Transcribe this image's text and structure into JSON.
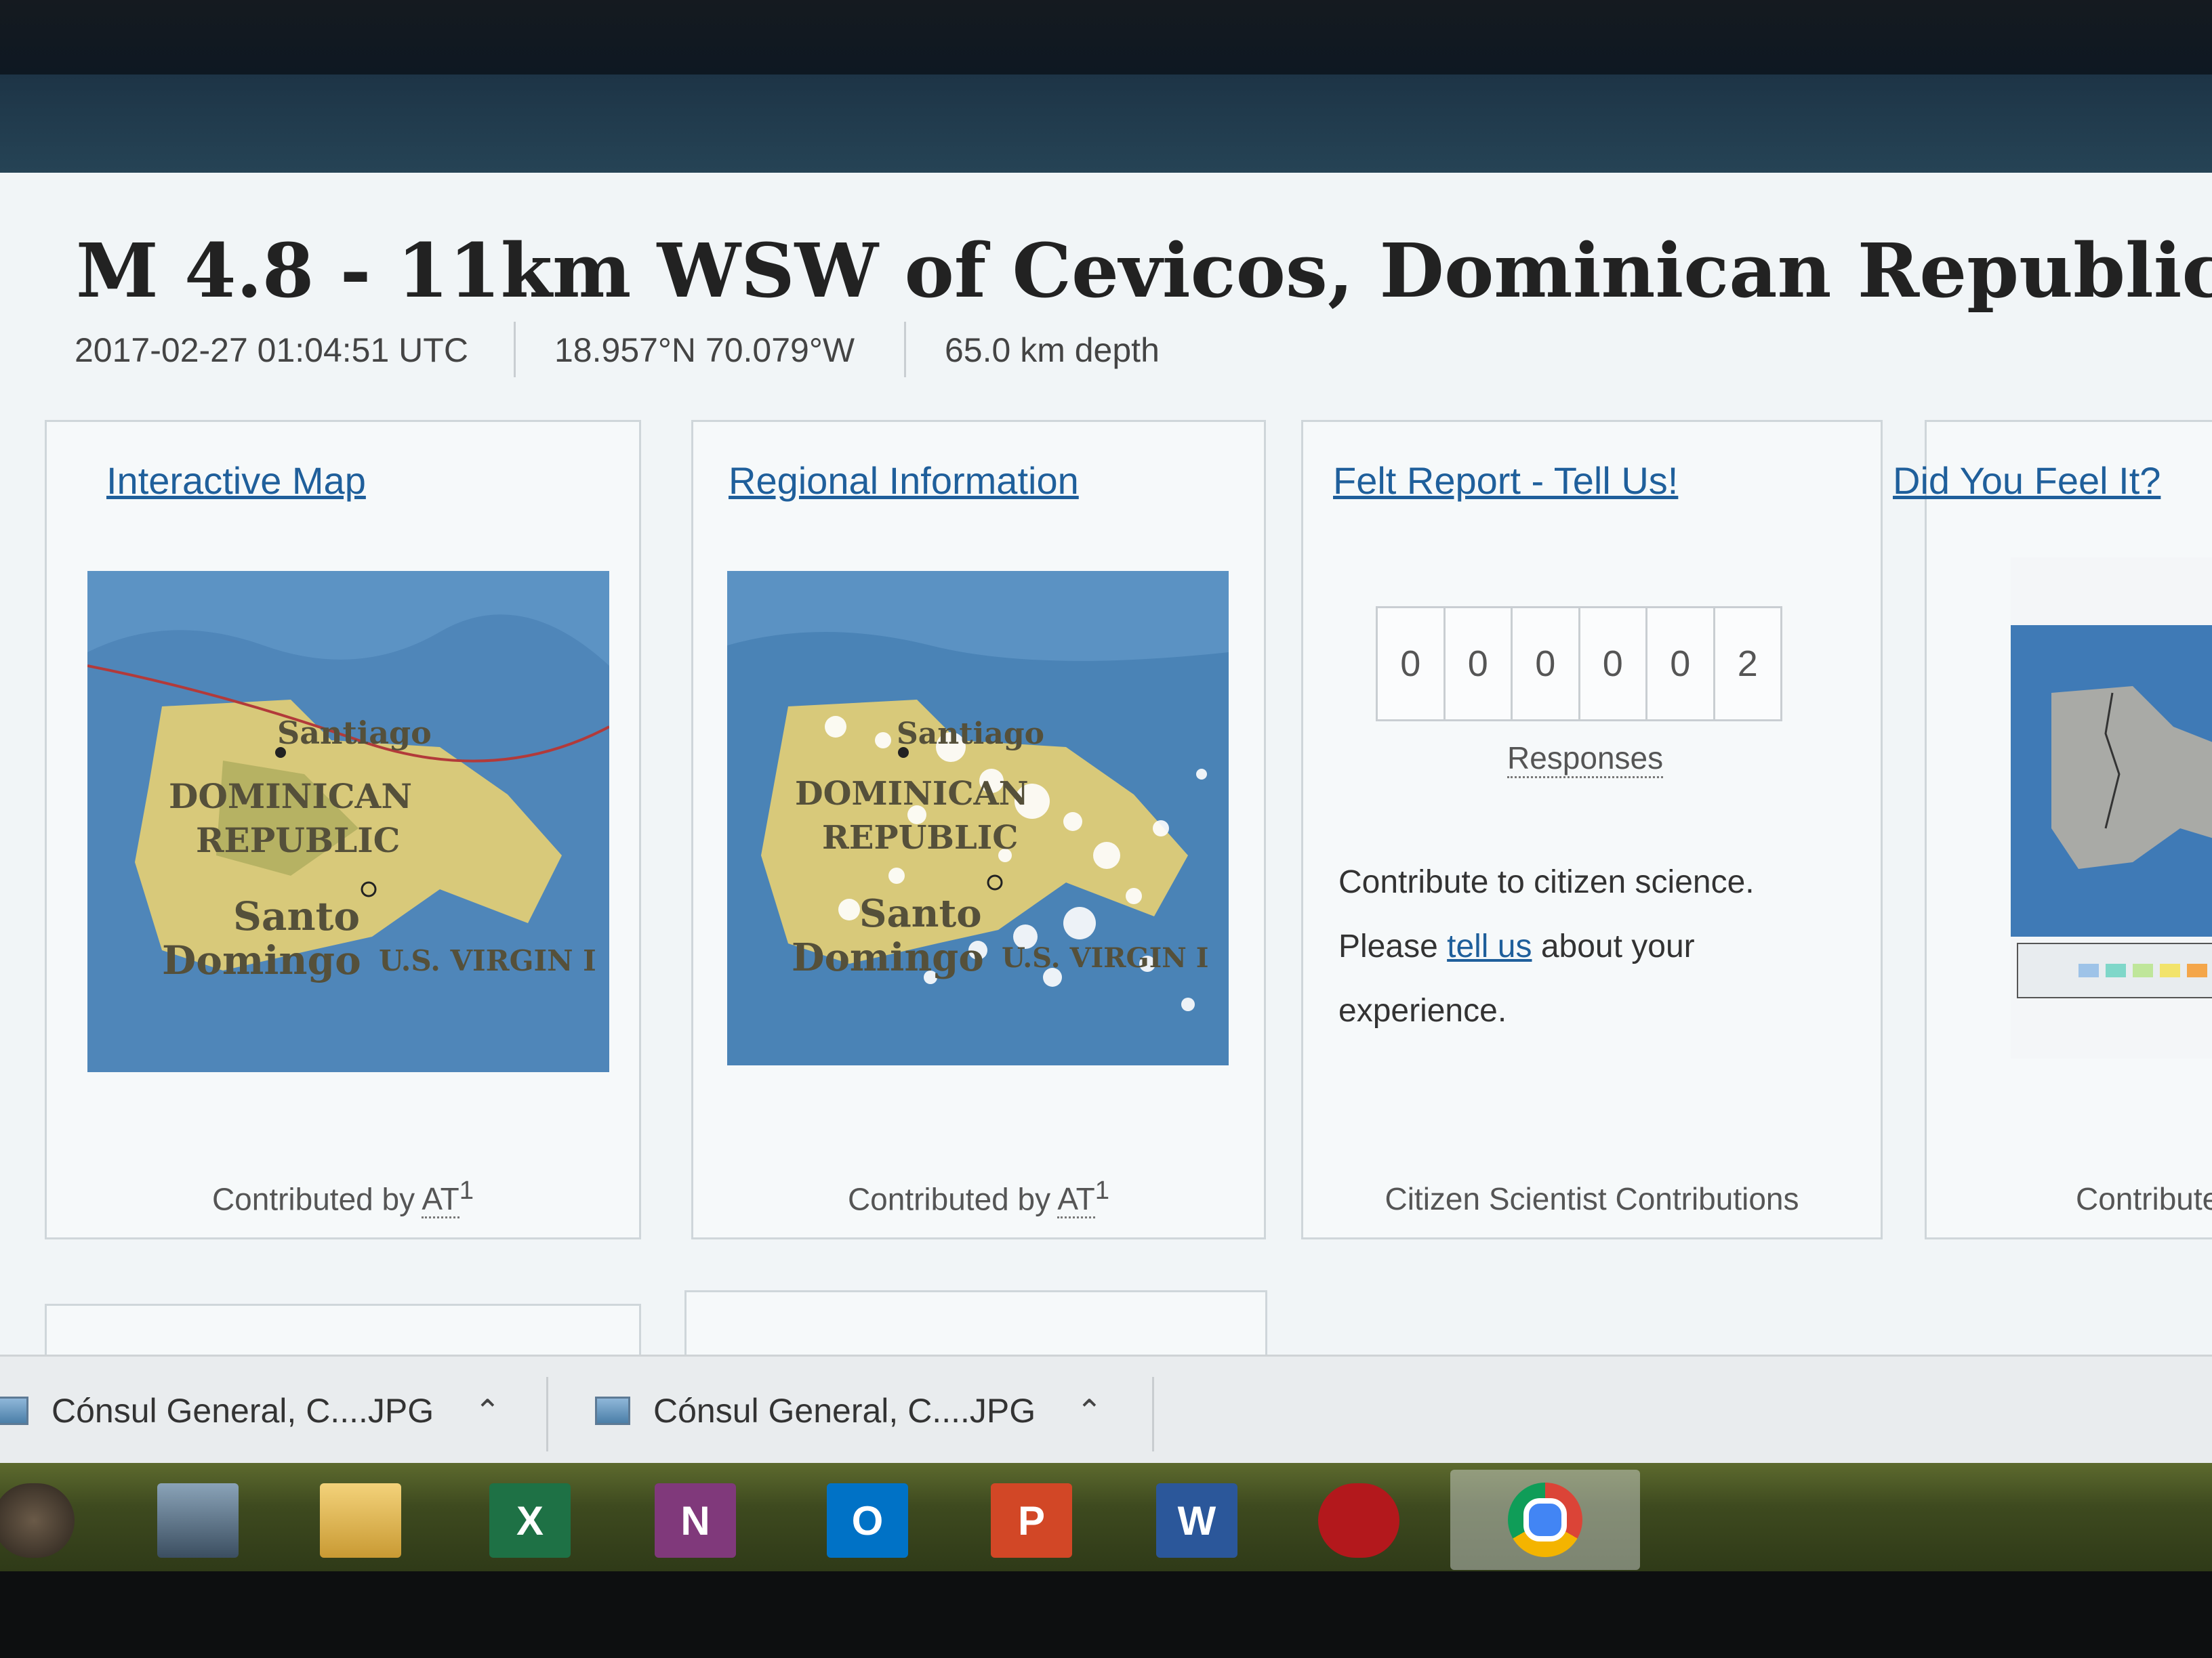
{
  "event": {
    "title": "M 4.8 - 11km WSW of Cevicos, Dominican Republic",
    "time": "2017-02-27 01:04:51 UTC",
    "coordinates": "18.957°N  70.079°W",
    "depth": "65.0 km depth"
  },
  "cards": {
    "interactive_map": {
      "link": "Interactive Map",
      "footer_prefix": "Contributed by ",
      "footer_abbr": "AT",
      "footer_sup": "1",
      "map_labels": {
        "city1": "Santiago",
        "country1": "DOMINICAN",
        "country2": "REPUBLIC",
        "city2a": "Santo",
        "city2b": "Domingo",
        "region": "U.S. VIRGIN I"
      }
    },
    "regional_information": {
      "link": "Regional Information",
      "footer_prefix": "Contributed by ",
      "footer_abbr": "AT",
      "footer_sup": "1",
      "map_labels": {
        "city1": "Santiago",
        "country1": "DOMINICAN",
        "country2": "REPUBLIC",
        "city2a": "Santo",
        "city2b": "Domingo",
        "region": "U.S. VIRGIN I"
      }
    },
    "felt_report": {
      "link": "Felt Report - Tell Us!",
      "digits": [
        "0",
        "0",
        "0",
        "0",
        "0",
        "2"
      ],
      "responses_label": "Responses",
      "line1": "Contribute to citizen science.",
      "line2_prefix": "Please ",
      "line2_link": "tell us",
      "line2_suffix": " about your",
      "line3": "experience.",
      "footer": "Citizen Scientist Contributions"
    },
    "dyfi": {
      "link": "Did You Feel It?",
      "footer": "Contribute"
    }
  },
  "downloads": [
    {
      "name": "Cónsul General, C....JPG"
    },
    {
      "name": "Cónsul General, C....JPG"
    }
  ],
  "taskbar": {
    "apps": [
      {
        "name": "media-player",
        "glyph": ""
      },
      {
        "name": "games",
        "glyph": ""
      },
      {
        "name": "file-explorer",
        "glyph": ""
      },
      {
        "name": "excel",
        "glyph": "X",
        "color": "#1e7145"
      },
      {
        "name": "onenote",
        "glyph": "N",
        "color": "#80397b"
      },
      {
        "name": "outlook",
        "glyph": "O",
        "color": "#0072c6"
      },
      {
        "name": "powerpoint",
        "glyph": "P",
        "color": "#d24726"
      },
      {
        "name": "word",
        "glyph": "W",
        "color": "#2b579a"
      },
      {
        "name": "security-app",
        "glyph": "",
        "color": "#b3181c"
      },
      {
        "name": "chrome",
        "glyph": ""
      }
    ]
  },
  "colors": {
    "link": "#1f5f9b",
    "title": "#222222",
    "page_bg": "#f1f5f7"
  }
}
